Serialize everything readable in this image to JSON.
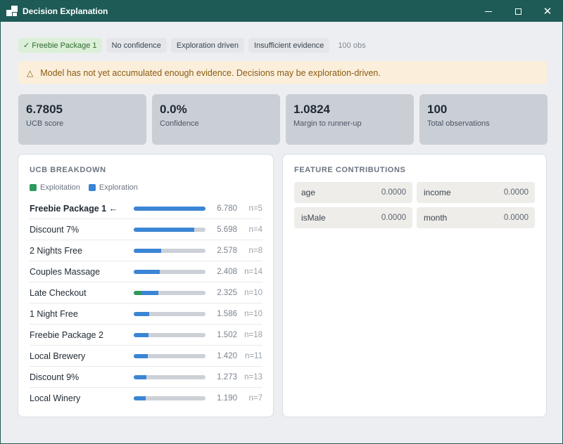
{
  "window": {
    "title": "Decision Explanation",
    "controls": {
      "minimize": "minimize",
      "maximize": "maximize",
      "close": "✕"
    }
  },
  "chips": {
    "selected": "Freebie Package 1",
    "selected_mark": "✓",
    "confidence": "No confidence",
    "driver": "Exploration driven",
    "evidence": "Insufficient evidence",
    "observations": "100 obs"
  },
  "banner": {
    "icon": "warning-triangle-icon",
    "glyph": "△",
    "text": "Model has not yet accumulated enough evidence. Decisions may be exploration-driven."
  },
  "stats": [
    {
      "value": "6.7805",
      "label": "UCB score"
    },
    {
      "value": "0.0%",
      "label": "Confidence"
    },
    {
      "value": "1.0824",
      "label": "Margin to runner-up"
    },
    {
      "value": "100",
      "label": "Total observations"
    }
  ],
  "ucb": {
    "title": "UCB BREAKDOWN",
    "legend": {
      "exploitation": "Exploitation",
      "exploration": "Exploration"
    },
    "colors": {
      "exploitation": "#2e9a5e",
      "exploration": "#3b85d4",
      "track": "#ccd1d7"
    },
    "rows": [
      {
        "name": "Freebie Package 1 ←",
        "score": "6.780",
        "n": "n=5",
        "exploit_frac": 0.0,
        "explore_frac": 1.0
      },
      {
        "name": "Discount 7%",
        "score": "5.698",
        "n": "n=4",
        "exploit_frac": 0.0,
        "explore_frac": 0.84
      },
      {
        "name": "2 Nights Free",
        "score": "2.578",
        "n": "n=8",
        "exploit_frac": 0.0,
        "explore_frac": 0.38
      },
      {
        "name": "Couples Massage",
        "score": "2.408",
        "n": "n=14",
        "exploit_frac": 0.0,
        "explore_frac": 0.36
      },
      {
        "name": "Late Checkout",
        "score": "2.325",
        "n": "n=10",
        "exploit_frac": 0.11,
        "explore_frac": 0.23
      },
      {
        "name": "1 Night Free",
        "score": "1.586",
        "n": "n=10",
        "exploit_frac": 0.0,
        "explore_frac": 0.22
      },
      {
        "name": "Freebie Package 2",
        "score": "1.502",
        "n": "n=18",
        "exploit_frac": 0.0,
        "explore_frac": 0.21
      },
      {
        "name": "Local Brewery",
        "score": "1.420",
        "n": "n=11",
        "exploit_frac": 0.0,
        "explore_frac": 0.2
      },
      {
        "name": "Discount 9%",
        "score": "1.273",
        "n": "n=13",
        "exploit_frac": 0.0,
        "explore_frac": 0.18
      },
      {
        "name": "Local Winery",
        "score": "1.190",
        "n": "n=7",
        "exploit_frac": 0.0,
        "explore_frac": 0.17
      }
    ]
  },
  "features": {
    "title": "FEATURE CONTRIBUTIONS",
    "items": [
      {
        "name": "age",
        "value": "0.0000"
      },
      {
        "name": "income",
        "value": "0.0000"
      },
      {
        "name": "isMale",
        "value": "0.0000"
      },
      {
        "name": "month",
        "value": "0.0000"
      }
    ]
  }
}
